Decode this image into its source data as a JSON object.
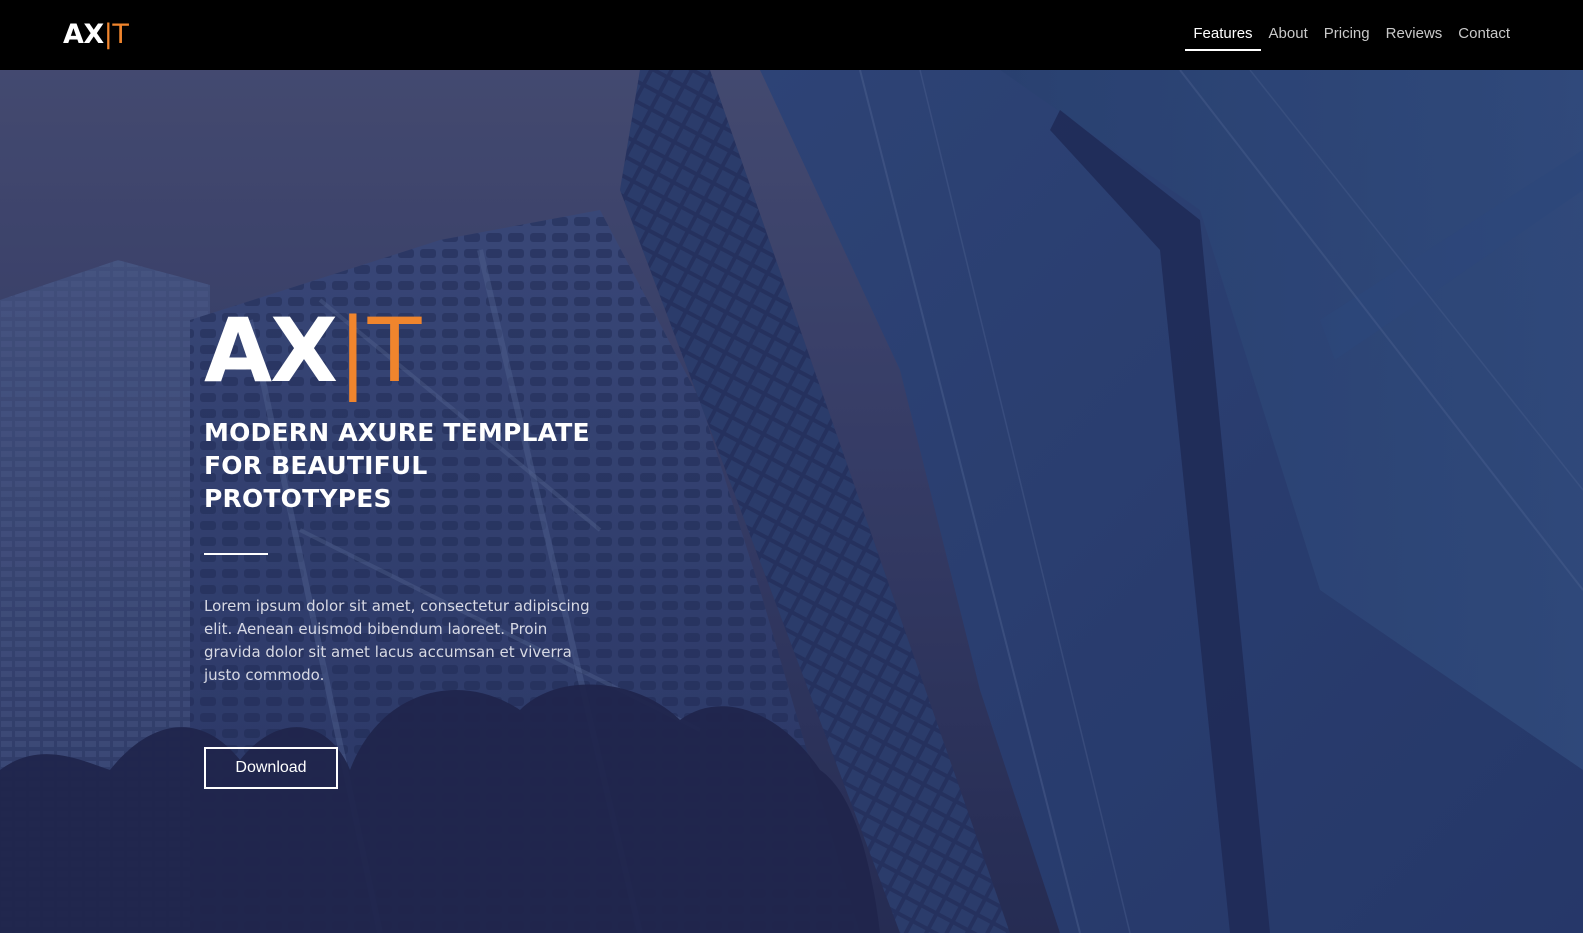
{
  "header": {
    "brand": {
      "part1": "AX",
      "separator": "|",
      "part2": "T"
    },
    "nav": [
      {
        "label": "Features",
        "active": true
      },
      {
        "label": "About",
        "active": false
      },
      {
        "label": "Pricing",
        "active": false
      },
      {
        "label": "Reviews",
        "active": false
      },
      {
        "label": "Contact",
        "active": false
      }
    ]
  },
  "hero": {
    "logo": {
      "part1": "AX",
      "separator": "|",
      "part2": "T"
    },
    "headline_lines": [
      "MODERN AXURE TEMPLATE",
      "FOR BEAUTIFUL",
      "PROTOTYPES"
    ],
    "body": "Lorem ipsum dolor sit amet, consectetur adipiscing elit. Aenean euismod bibendum laoreet. Proin gravida dolor sit amet lacus accumsan et viverra justo commodo.",
    "button_label": "Download"
  },
  "colors": {
    "accent": "#f0852d",
    "nav_bg": "#000000",
    "hero_overlay": "#2b3160"
  }
}
